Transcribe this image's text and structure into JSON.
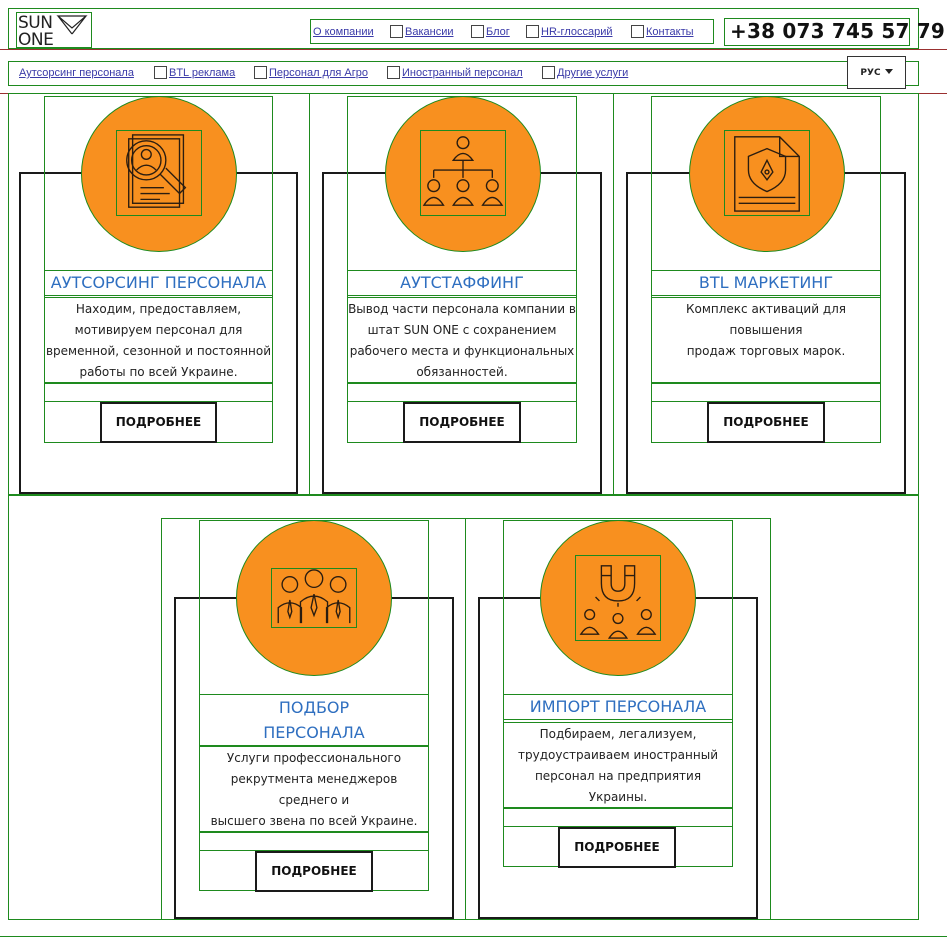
{
  "header": {
    "logo_line1": "SUN",
    "logo_line2": "ONE",
    "nav": [
      "О компании",
      "Вакансии",
      "Блог",
      "HR-глоссарий",
      "Контакты"
    ],
    "phone": "+38 073 745 57 79"
  },
  "subnav": [
    "Аутсорсинг персонала",
    "BTL реклама",
    "Персонал для Агро",
    "Иностранный персонал",
    "Другие услуги"
  ],
  "lang": {
    "label": "РУС"
  },
  "cards": [
    {
      "title": "АУТСОРСИНГ ПЕРСОНАЛА",
      "desc": [
        "Находим, предоставляем,",
        "мотивируем персонал для",
        "временной, сезонной и постоянной",
        "работы по всей Украине."
      ],
      "button": "ПОДРОБНЕЕ",
      "icon": "magnifier-resume-icon"
    },
    {
      "title": "АУТСТАФФИНГ",
      "desc": [
        "Вывод части персонала компании в",
        "штат SUN ONE с сохранением",
        "рабочего места и функциональных",
        "обязанностей."
      ],
      "button": "ПОДРОБНЕЕ",
      "icon": "org-chart-icon"
    },
    {
      "title": "BTL МАРКЕТИНГ",
      "desc": [
        "Комплекс активаций для повышения",
        "продаж торговых марок."
      ],
      "button": "ПОДРОБНЕЕ",
      "icon": "document-pen-icon"
    },
    {
      "title_lines": [
        "ПОДБОР",
        "ПЕРСОНАЛА"
      ],
      "desc": [
        "Услуги профессионального",
        "рекрутмента менеджеров среднего и",
        "высшего звена по всей Украине."
      ],
      "button": "ПОДРОБНЕЕ",
      "icon": "team-icon"
    },
    {
      "title": "ИМПОРТ ПЕРСОНАЛА",
      "desc": [
        "Подбираем, легализуем,",
        "трудоустраиваем иностранный",
        "персонал на предприятия Украины."
      ],
      "button": "ПОДРОБНЕЕ",
      "icon": "magnet-people-icon"
    }
  ],
  "colors": {
    "accent": "#f8901f",
    "title": "#2f6fc0",
    "link": "#3a3aa8",
    "outline": "#1e8a1e"
  }
}
